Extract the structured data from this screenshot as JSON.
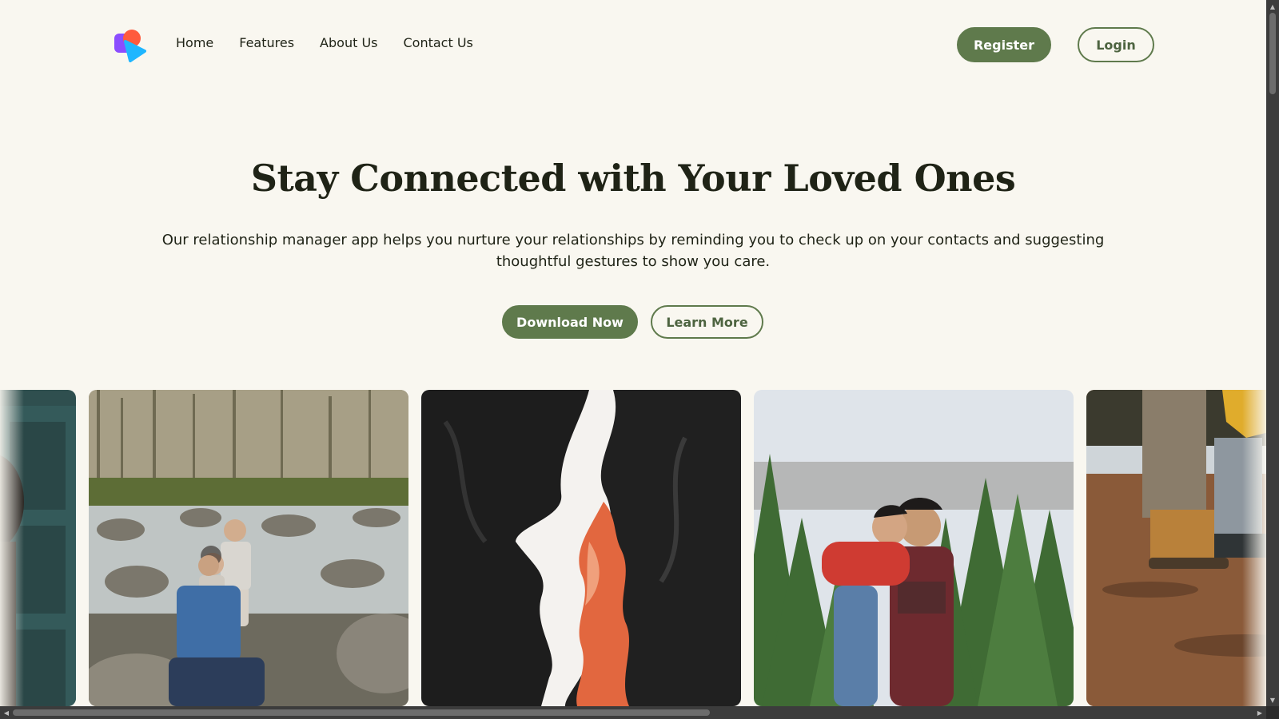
{
  "nav": {
    "links": [
      "Home",
      "Features",
      "About Us",
      "Contact Us"
    ],
    "register_label": "Register",
    "login_label": "Login",
    "logo_icon": "chat-bubbles-logo-icon"
  },
  "hero": {
    "title": "Stay Connected with Your Loved Ones",
    "text": "Our relationship manager app helps you nurture your relationships by reminding you to check up on your contacts and suggesting thoughtful gestures to show you care.",
    "download_label": "Download Now",
    "learn_label": "Learn More"
  },
  "gallery": {
    "images": [
      "person-by-teal-door-photo",
      "family-by-rocky-river-photo",
      "canyon-rock-silhouettes-photo",
      "father-hugging-son-pine-trees-photo",
      "walking-boots-on-dirt-path-photo"
    ]
  },
  "colors": {
    "background": "#f9f7f0",
    "accent": "#5f7a4c",
    "text": "#1f2316"
  }
}
